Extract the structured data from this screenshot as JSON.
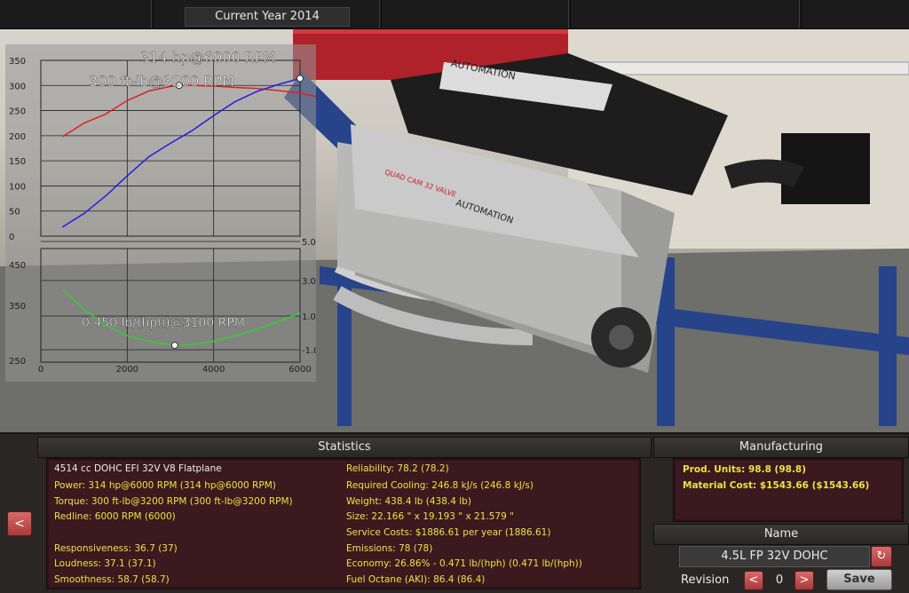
{
  "topbar": {
    "year_label": "Current Year 2014"
  },
  "graph": {
    "power_peak_label": "314 hp@6000 RPM",
    "torque_peak_label": "300 ft-lb@3200 RPM",
    "bsfc_min_label": "0.450 lb/(hph)@3100 RPM",
    "colors": {
      "power": "#2020e0",
      "torque": "#e02020",
      "bsfc": "#30d030"
    }
  },
  "chart_data": [
    {
      "type": "line",
      "title": "",
      "x_ticks": [
        "0",
        "2000",
        "4000",
        "6000"
      ],
      "xlim": [
        0,
        6000
      ],
      "y_ticks": [
        "0",
        "50",
        "100",
        "150",
        "200",
        "250",
        "300",
        "350"
      ],
      "ylim": [
        0,
        350
      ],
      "grid": true,
      "series": [
        {
          "name": "",
          "color": "#e02020",
          "x": [
            500,
            1000,
            1500,
            2000,
            2500,
            3000,
            3200,
            3500,
            4000,
            4500,
            5000,
            5500,
            6000,
            6500
          ],
          "y": [
            198,
            225,
            243,
            270,
            289,
            298,
            300,
            300,
            299,
            296,
            294,
            290,
            285,
            275
          ]
        },
        {
          "name": "",
          "color": "#2020e0",
          "x": [
            500,
            1000,
            1500,
            2000,
            2500,
            3000,
            3500,
            4000,
            4500,
            5000,
            5500,
            6000
          ],
          "y": [
            18,
            45,
            80,
            120,
            158,
            185,
            210,
            240,
            268,
            288,
            302,
            314
          ]
        }
      ],
      "markers": [
        {
          "x": 3200,
          "y": 300
        },
        {
          "x": 6000,
          "y": 314
        }
      ]
    },
    {
      "type": "line",
      "title": "",
      "x_ticks": [
        "0",
        "2000",
        "4000",
        "6000"
      ],
      "xlim": [
        0,
        6000
      ],
      "y_ticks": [
        "250",
        "350",
        "450"
      ],
      "ylim": [
        250,
        470
      ],
      "y2_ticks": [
        "-1.0",
        "1.0",
        "3.0",
        "5.0"
      ],
      "grid": true,
      "series": [
        {
          "name": "",
          "color": "#30d030",
          "x": [
            500,
            1000,
            1500,
            2000,
            2500,
            3100,
            3500,
            4000,
            4500,
            5000,
            5500,
            6000
          ],
          "y": [
            0.52,
            0.495,
            0.475,
            0.462,
            0.455,
            0.45,
            0.451,
            0.455,
            0.462,
            0.47,
            0.48,
            0.49
          ]
        }
      ],
      "markers": [
        {
          "x": 3100,
          "y": 0.45
        }
      ]
    }
  ],
  "statistics": {
    "header": "Statistics",
    "left": [
      "4514 cc DOHC EFI 32V V8 Flatplane",
      "Power: 314 hp@6000 RPM (314 hp@6000 RPM)",
      "Torque: 300 ft-lb@3200 RPM (300 ft-lb@3200 RPM)",
      "Redline: 6000 RPM (6000)",
      "Responsiveness: 36.7 (37)",
      "Loudness: 37.1 (37.1)",
      "Smoothness: 58.7 (58.7)"
    ],
    "right": [
      "Reliability: 78.2 (78.2)",
      "Required Cooling: 246.8 kJ/s (246.8 kJ/s)",
      "Weight: 438.4 lb (438.4 lb)",
      "Size: 22.166 \" x 19.193 \" x 21.579 \"",
      "Service Costs: $1886.61 per year (1886.61)",
      "Emissions: 78 (78)",
      "Economy: 26.86% - 0.471 lb/(hph) (0.471 lb/(hph))",
      "Fuel Octane (AKI): 86.4 (86.4)"
    ]
  },
  "manufacturing": {
    "header": "Manufacturing",
    "prod_units": "Prod. Units: 98.8 (98.8)",
    "material_cost": "Material Cost: $1543.66 ($1543.66)"
  },
  "name_panel": {
    "header": "Name",
    "engine_name": "4.5L FP 32V DOHC",
    "revision_label": "Revision",
    "revision_value": "0",
    "save_label": "Save",
    "prev_arrow": "<",
    "next_arrow": ">"
  },
  "left_arrow": "<"
}
